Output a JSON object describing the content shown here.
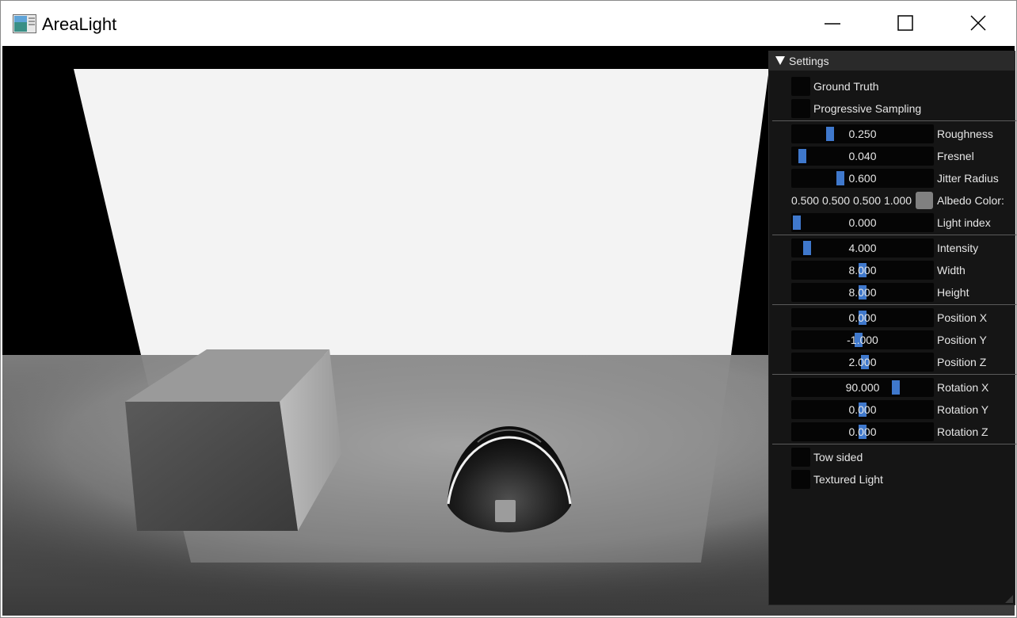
{
  "window": {
    "title": "AreaLight"
  },
  "settings": {
    "header": "Settings",
    "ground_truth": "Ground Truth",
    "progressive_sampling": "Progressive Sampling",
    "roughness": {
      "value": "0.250",
      "label": "Roughness",
      "fraction": 0.25
    },
    "fresnel": {
      "value": "0.040",
      "label": "Fresnel",
      "fraction": 0.04
    },
    "jitter_radius": {
      "value": "0.600",
      "label": "Jitter Radius",
      "fraction": 0.33
    },
    "albedo": {
      "r": "0.500",
      "g": "0.500",
      "b": "0.500",
      "a": "1.000",
      "label": "Albedo Color:",
      "swatch": "#808080"
    },
    "light_index": {
      "value": "0.000",
      "label": "Light index",
      "fraction": 0.0
    },
    "intensity": {
      "value": "4.000",
      "label": "Intensity",
      "fraction": 0.08
    },
    "width": {
      "value": "8.000",
      "label": "Width",
      "fraction": 0.5
    },
    "height": {
      "value": "8.000",
      "label": "Height",
      "fraction": 0.5
    },
    "position_x": {
      "value": "0.000",
      "label": "Position X",
      "fraction": 0.5
    },
    "position_y": {
      "value": "-1.000",
      "label": "Position Y",
      "fraction": 0.47
    },
    "position_z": {
      "value": "2.000",
      "label": "Position Z",
      "fraction": 0.52
    },
    "rotation_x": {
      "value": "90.000",
      "label": "Rotation X",
      "fraction": 0.75
    },
    "rotation_y": {
      "value": "0.000",
      "label": "Rotation Y",
      "fraction": 0.5
    },
    "rotation_z": {
      "value": "0.000",
      "label": "Rotation Z",
      "fraction": 0.5
    },
    "tow_sided": "Tow sided",
    "textured_light": "Textured Light"
  },
  "colors": {
    "accent": "#3f78cc",
    "panel_bg": "#151515"
  }
}
